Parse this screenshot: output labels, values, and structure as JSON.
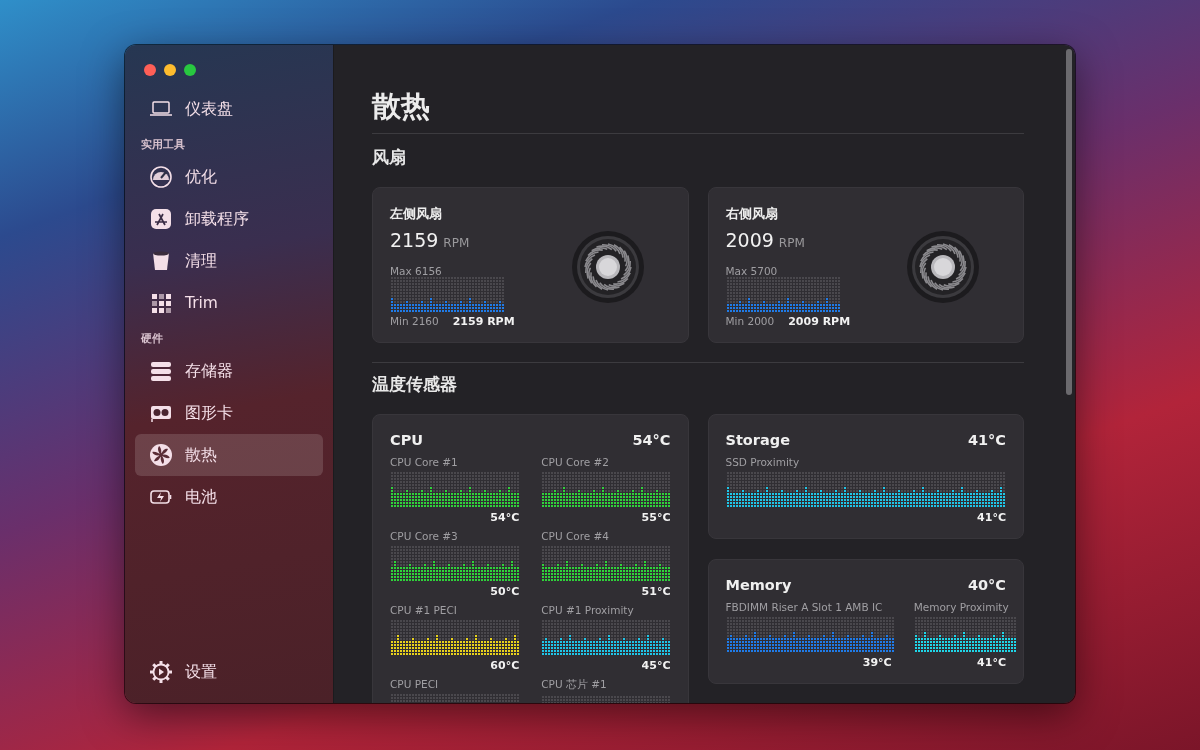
{
  "sidebar": {
    "top": {
      "label": "仪表盘",
      "selected": false
    },
    "sections": [
      {
        "header": "实用工具",
        "items": [
          {
            "label": "优化",
            "selected": false
          },
          {
            "label": "卸载程序",
            "selected": false
          },
          {
            "label": "清理",
            "selected": false
          },
          {
            "label": "Trim",
            "selected": false
          }
        ]
      },
      {
        "header": "硬件",
        "items": [
          {
            "label": "存储器",
            "selected": false
          },
          {
            "label": "图形卡",
            "selected": false
          },
          {
            "label": "散热",
            "selected": true
          },
          {
            "label": "电池",
            "selected": false
          }
        ]
      }
    ],
    "footer": {
      "label": "设置",
      "selected": false
    }
  },
  "page_title": "散热",
  "fans": {
    "title": "风扇",
    "items": [
      {
        "name": "左侧风扇",
        "rpm": "2159",
        "unit": "RPM",
        "max": "Max 6156",
        "min": "Min 2160",
        "reading": "2159 RPM"
      },
      {
        "name": "右侧风扇",
        "rpm": "2009",
        "unit": "RPM",
        "max": "Max 5700",
        "min": "Min 2000",
        "reading": "2009 RPM"
      }
    ]
  },
  "temperature": {
    "title": "温度传感器",
    "columns": [
      [
        {
          "name": "CPU",
          "value": "54°C",
          "sensors": [
            {
              "name": "CPU Core #1",
              "value": "54°C",
              "color": "#2fd33a"
            },
            {
              "name": "CPU Core #2",
              "value": "55°C",
              "color": "#2fd33a"
            },
            {
              "name": "CPU Core #3",
              "value": "50°C",
              "color": "#2fd33a"
            },
            {
              "name": "CPU Core #4",
              "value": "51°C",
              "color": "#2fd33a"
            },
            {
              "name": "CPU #1 PECI",
              "value": "60°C",
              "color": "#e8d21c"
            },
            {
              "name": "CPU #1 Proximity",
              "value": "45°C",
              "color": "#1fc6e8"
            },
            {
              "name": "CPU PECI"
            },
            {
              "name": "CPU 芯片 #1"
            }
          ]
        }
      ],
      [
        {
          "name": "Storage",
          "value": "41°C",
          "sensors": [
            {
              "name": "SSD Proximity",
              "value": "41°C",
              "color": "#1fc6e8"
            }
          ]
        },
        {
          "name": "Memory",
          "value": "40°C",
          "sensors": [
            {
              "name": "FBDIMM Riser A Slot 1 AMB IC",
              "value": "39°C",
              "color": "#1f7be8"
            },
            {
              "name": "Memory Proximity",
              "value": "41°C",
              "color": "#1fd6e8"
            }
          ]
        }
      ]
    ]
  }
}
